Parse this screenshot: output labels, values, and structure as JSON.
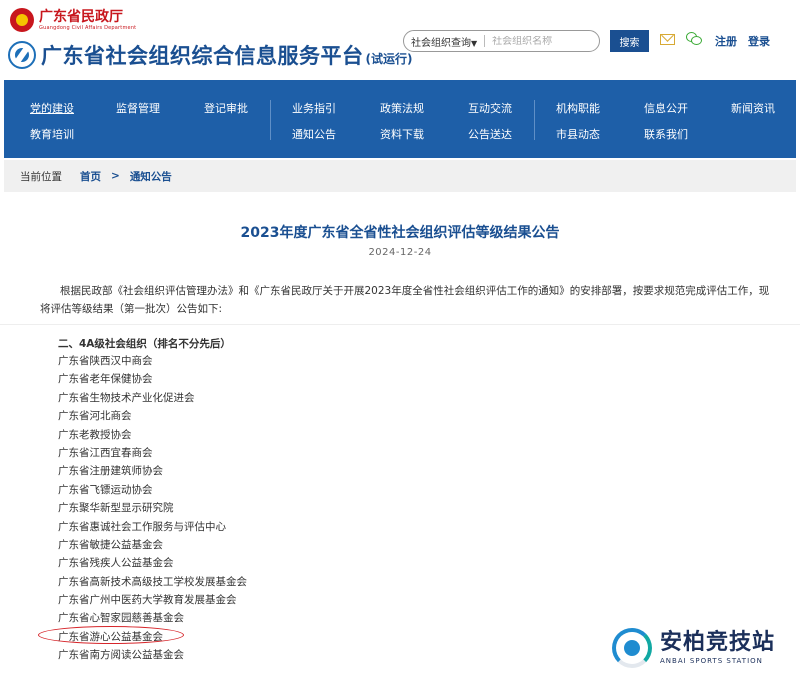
{
  "header": {
    "dept_name": "广东省民政厅",
    "dept_subtitle": "Guangdong Civil Affairs Department",
    "platform_title": "广东省社会组织综合信息服务平台",
    "platform_suffix": "(试运行)",
    "search": {
      "type_label": "社会组织查询",
      "placeholder": "社会组织名称",
      "button_label": "搜索"
    },
    "register_label": "注册",
    "login_label": "登录",
    "icons": [
      "mail-icon",
      "wechat-icon"
    ]
  },
  "nav": {
    "row1": [
      "党的建设",
      "监督管理",
      "登记审批",
      "业务指引",
      "政策法规",
      "互动交流",
      "机构职能",
      "信息公开",
      "新闻资讯"
    ],
    "row2": [
      "教育培训",
      "通知公告",
      "资料下载",
      "公告送达",
      "市县动态",
      "联系我们"
    ],
    "active": "党的建设"
  },
  "breadcrumb": {
    "label": "当前位置",
    "home": "首页",
    "separator": ">",
    "current": "通知公告"
  },
  "article": {
    "title": "2023年度广东省全省性社会组织评估等级结果公告",
    "date": "2024-12-24",
    "intro": "根据民政部《社会组织评估管理办法》和《广东省民政厅关于开展2023年度全省性社会组织评估工作的通知》的安排部署，按要求规范完成评估工作，现将评估等级结果（第一批次）公告如下:",
    "section_heading": "二、4A级社会组织（排名不分先后）",
    "organizations": [
      "广东省陕西汉中商会",
      "广东省老年保健协会",
      "广东省生物技术产业化促进会",
      "广东省河北商会",
      "广东老教授协会",
      "广东省江西宜春商会",
      "广东省注册建筑师协会",
      "广东省飞镖运动协会",
      "广东聚华新型显示研究院",
      "广东省惠诚社会工作服务与评估中心",
      "广东省敏捷公益基金会",
      "广东省残疾人公益基金会",
      "广东省高新技术高级技工学校发展基金会",
      "广东省广州中医药大学教育发展基金会",
      "广东省心智家园慈善基金会",
      "广东省游心公益基金会",
      "广东省南方阅读公益基金会"
    ],
    "highlighted": "广东省游心公益基金会"
  },
  "watermark": {
    "name": "安柏竞技站",
    "subtitle": "ANBAI SPORTS STATION"
  },
  "colors": {
    "brand_blue": "#1a4f91",
    "nav_blue": "#1e5fa8",
    "dept_red": "#c8161d",
    "highlight_red": "#d6252a"
  }
}
